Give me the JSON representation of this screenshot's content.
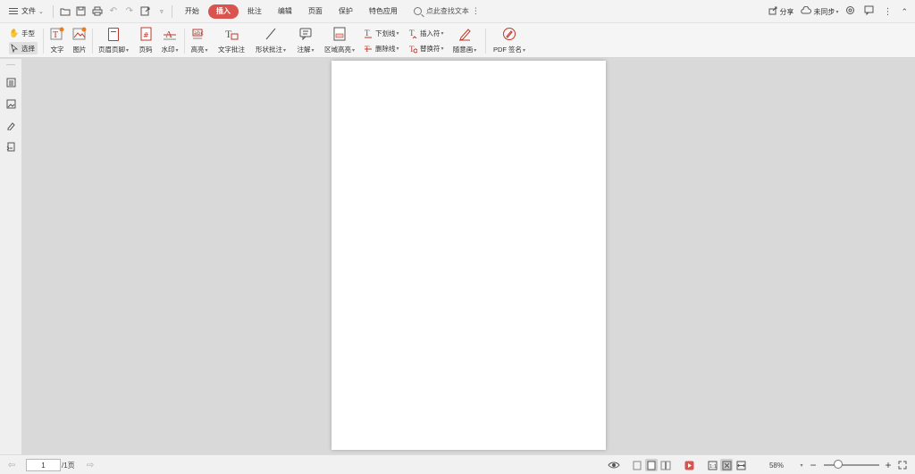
{
  "menubar": {
    "file_label": "文件",
    "tabs": [
      {
        "label": "开始",
        "active": false
      },
      {
        "label": "插入",
        "active": true
      },
      {
        "label": "批注",
        "active": false
      },
      {
        "label": "编辑",
        "active": false
      },
      {
        "label": "页面",
        "active": false
      },
      {
        "label": "保护",
        "active": false
      },
      {
        "label": "特色应用",
        "active": false
      }
    ],
    "search_label": "点此查找文本",
    "share_label": "分享",
    "sync_label": "未同步"
  },
  "ribbon": {
    "hand_label": "手型",
    "select_label": "选择",
    "text_label": "文字",
    "image_label": "图片",
    "header_footer_label": "页眉页脚",
    "page_number_label": "页码",
    "watermark_label": "水印",
    "highlight_label": "高亮",
    "text_comment_label": "文字批注",
    "shape_comment_label": "形状批注",
    "note_label": "注解",
    "area_highlight_label": "区域高亮",
    "underline_label": "下划线",
    "insert_char_label": "插入符",
    "strikethrough_label": "删除线",
    "replace_char_label": "替换符",
    "freehand_label": "随意画",
    "pdf_sign_label": "PDF 签名"
  },
  "statusbar": {
    "current_page": "1",
    "total_pages": "/1页",
    "zoom": "58%"
  },
  "colors": {
    "accent": "#d9534f",
    "icon_red": "#c0392b"
  }
}
